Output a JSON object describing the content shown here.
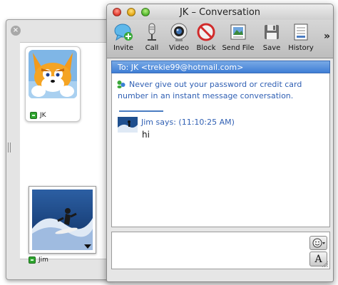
{
  "window": {
    "title": "JK – Conversation"
  },
  "toolbar": {
    "items": [
      {
        "label": "Invite",
        "icon": "invite-icon"
      },
      {
        "label": "Call",
        "icon": "microphone-icon"
      },
      {
        "label": "Video",
        "icon": "webcam-icon"
      },
      {
        "label": "Block",
        "icon": "block-icon"
      },
      {
        "label": "Send File",
        "icon": "send-file-icon"
      },
      {
        "label": "Save",
        "icon": "save-icon"
      },
      {
        "label": "History",
        "icon": "history-icon"
      }
    ],
    "overflow": "»"
  },
  "recipient_bar": {
    "text": "To: JK <trekie99@hotmail.com>"
  },
  "transcript": {
    "warning": "Never give out your password or credit card number in an instant message conversation.",
    "messages": [
      {
        "header": "Jim says: (11:10:25 AM)",
        "text": "hi"
      }
    ]
  },
  "side_panel": {
    "contact_name": "JK",
    "self_name": "Jim"
  },
  "input": {
    "font_button": "A"
  },
  "colors": {
    "accent_blue": "#3f7ed6",
    "link_blue": "#2f5fb3",
    "presence_green": "#2fa52f"
  }
}
